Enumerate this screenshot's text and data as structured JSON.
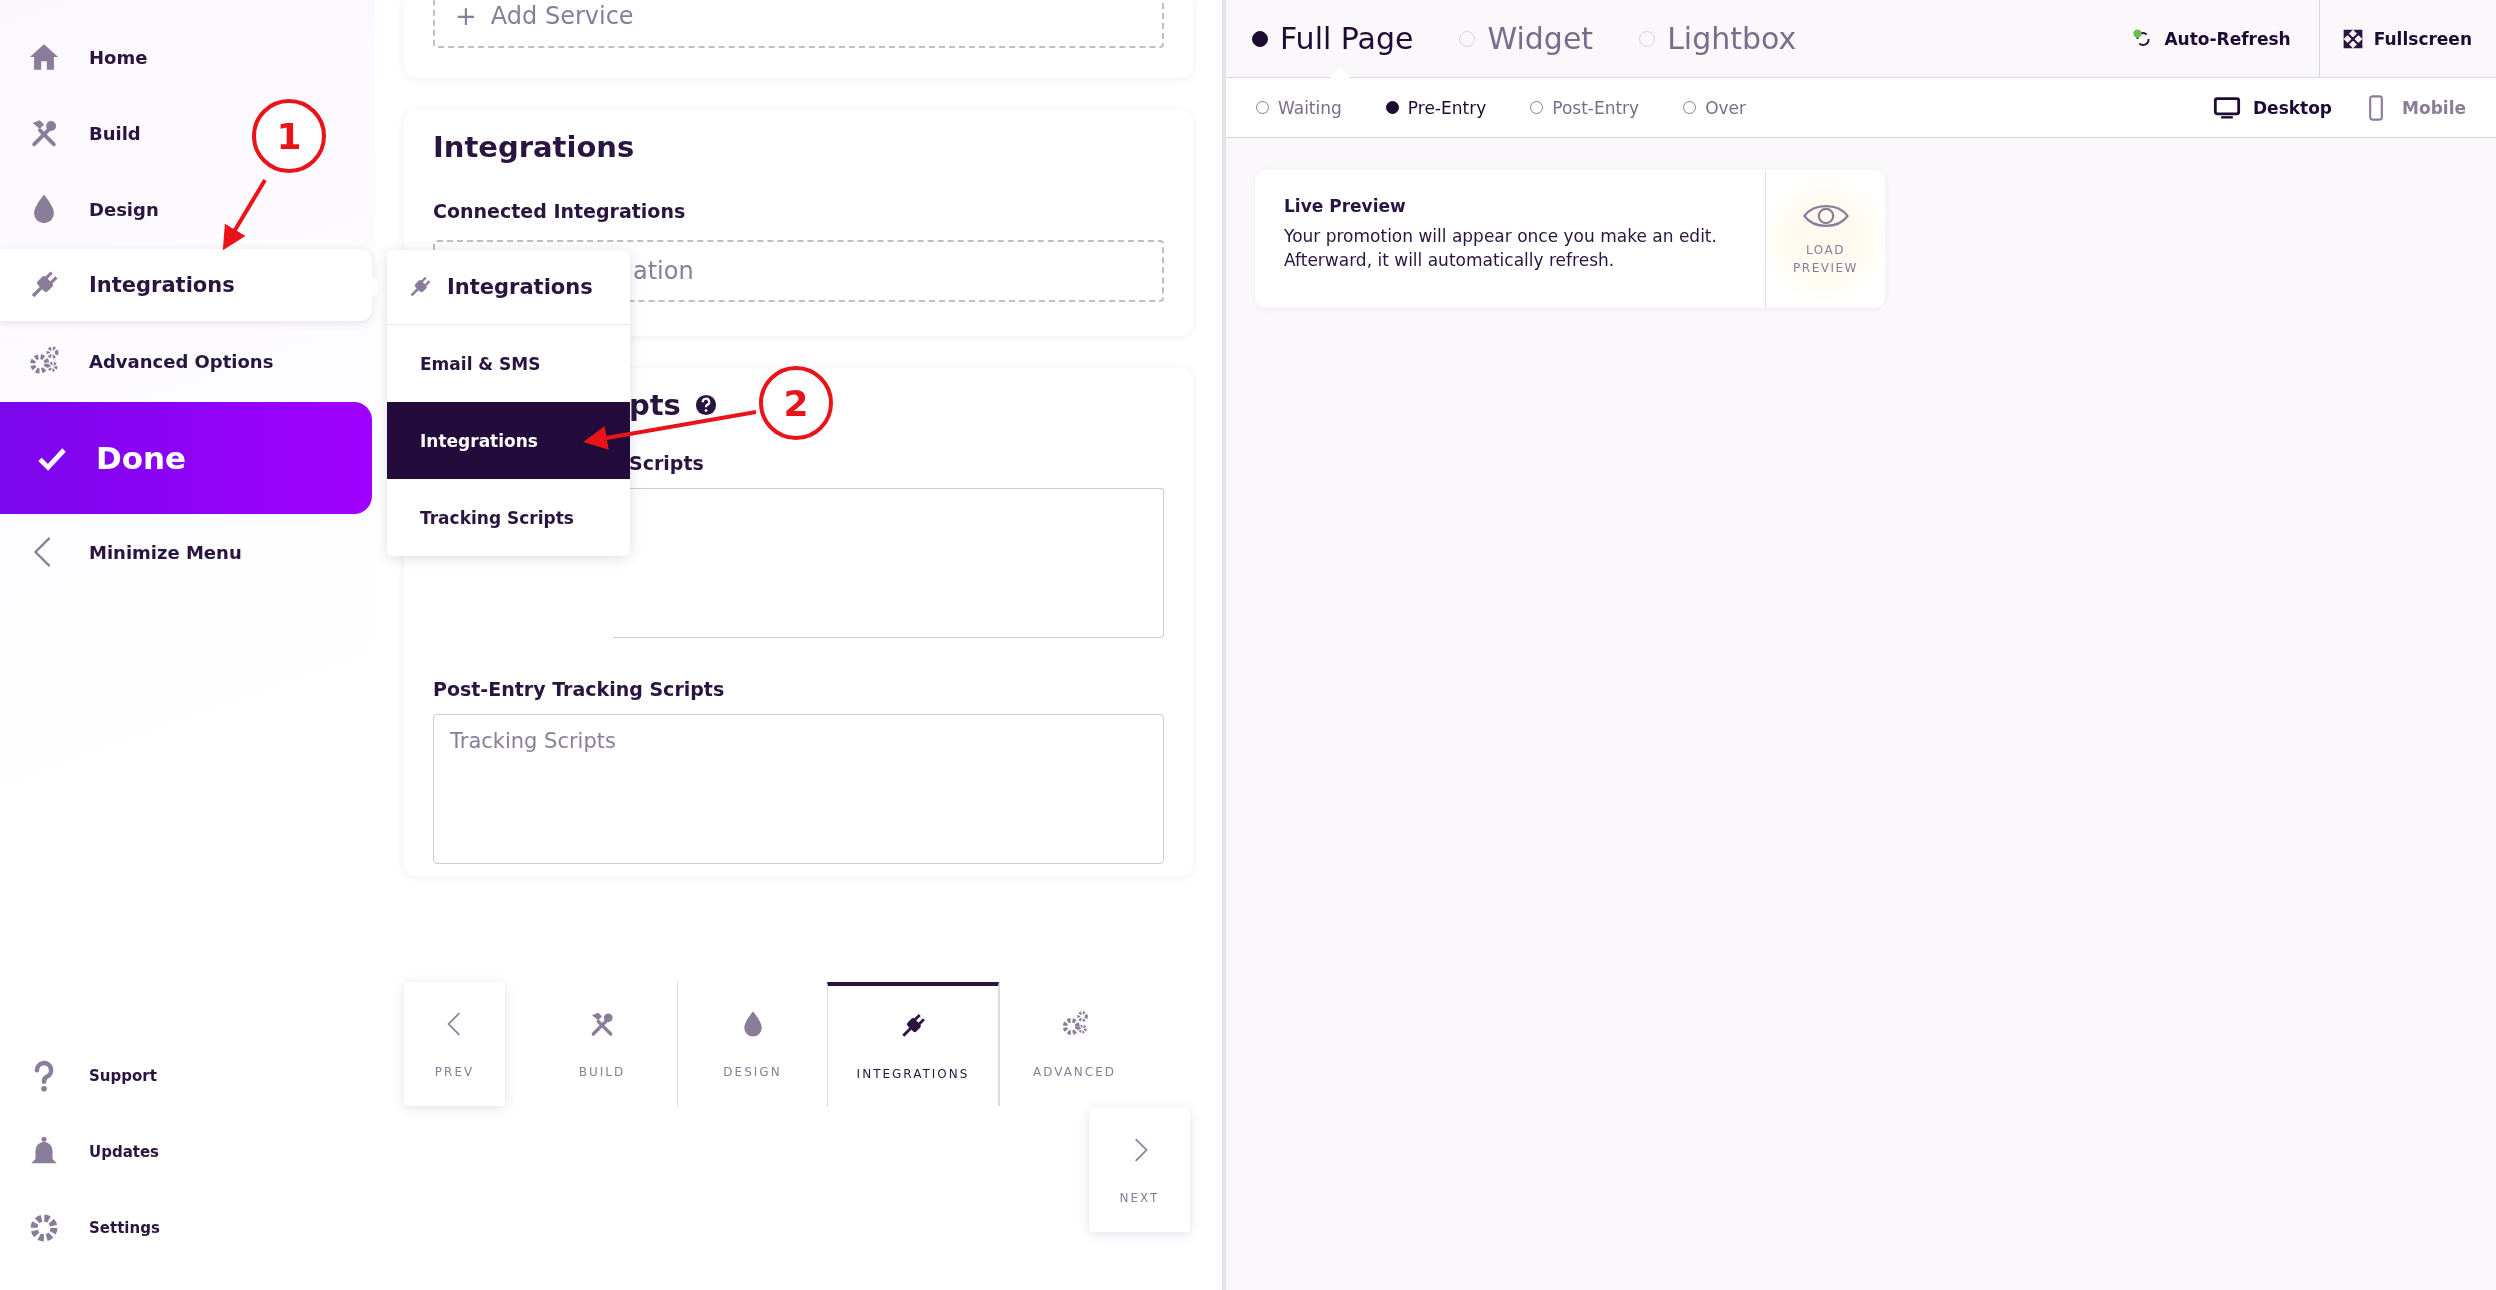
{
  "sidebar": {
    "items": [
      {
        "label": "Home",
        "kind": "home",
        "selected": false
      },
      {
        "label": "Build",
        "kind": "build",
        "selected": false
      },
      {
        "label": "Design",
        "kind": "drop",
        "selected": false
      },
      {
        "label": "Integrations",
        "kind": "plug",
        "selected": true
      },
      {
        "label": "Advanced Options",
        "kind": "gears",
        "selected": false
      }
    ],
    "done_button": "Done",
    "minimize": "Minimize Menu",
    "footer_items": [
      {
        "label": "Support",
        "kind": "help"
      },
      {
        "label": "Updates",
        "kind": "bell"
      },
      {
        "label": "Settings",
        "kind": "gear"
      }
    ]
  },
  "submenu": {
    "title": "Integrations",
    "items": [
      {
        "label": "Email & SMS",
        "selected": false
      },
      {
        "label": "Integrations",
        "selected": true
      },
      {
        "label": "Tracking Scripts",
        "selected": false
      }
    ]
  },
  "editor": {
    "add_service_plus": "+",
    "add_service": "Add Service",
    "integrations_card": {
      "title": "Integrations",
      "label": "Connected Integrations",
      "field_text": "ation"
    },
    "tracking_card": {
      "title_fragment": "pts",
      "field1_label_fragment": "Scripts",
      "field2_label": "Post-Entry Tracking Scripts",
      "field2_placeholder": "Tracking Scripts"
    }
  },
  "step_nav": {
    "prev": "PREV",
    "next": "NEXT",
    "steps": [
      {
        "label": "BUILD",
        "kind": "build",
        "selected": false
      },
      {
        "label": "DESIGN",
        "kind": "drop",
        "selected": false
      },
      {
        "label": "INTEGRATIONS",
        "kind": "plug",
        "selected": true
      },
      {
        "label": "ADVANCED",
        "kind": "gears",
        "selected": false
      }
    ]
  },
  "preview": {
    "modes": [
      {
        "label": "Full Page",
        "selected": true
      },
      {
        "label": "Widget",
        "selected": false
      },
      {
        "label": "Lightbox",
        "selected": false
      }
    ],
    "auto_refresh": "Auto-Refresh",
    "fullscreen": "Fullscreen",
    "states": [
      {
        "label": "Waiting",
        "selected": false
      },
      {
        "label": "Pre-Entry",
        "selected": true
      },
      {
        "label": "Post-Entry",
        "selected": false
      },
      {
        "label": "Over",
        "selected": false
      }
    ],
    "devices": [
      {
        "label": "Desktop",
        "kind": "desktop",
        "selected": true
      },
      {
        "label": "Mobile",
        "kind": "mobile",
        "selected": false
      }
    ],
    "card": {
      "title": "Live Preview",
      "text": "Your promotion will appear once you make an edit. Afterward, it will automatically refresh.",
      "button": "LOAD PREVIEW"
    }
  },
  "annotations": [
    {
      "label": "1"
    },
    {
      "label": "2"
    }
  ]
}
